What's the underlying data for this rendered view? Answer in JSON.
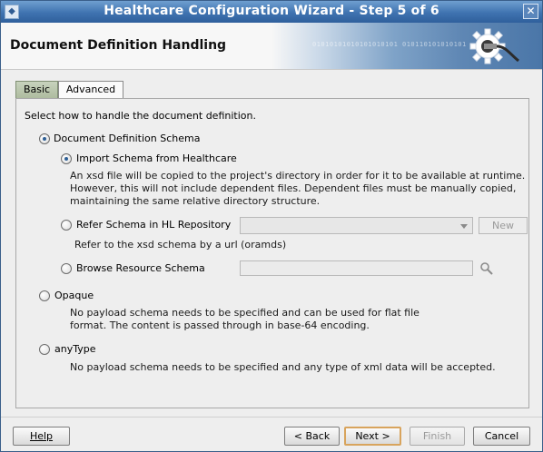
{
  "window": {
    "title": "Healthcare Configuration Wizard - Step 5 of 6",
    "close_glyph": "✕"
  },
  "header": {
    "heading": "Document Definition Handling",
    "banner_binary": "01010101010101010101 010110101010101"
  },
  "tabs": [
    {
      "label": "Basic",
      "selected": false
    },
    {
      "label": "Advanced",
      "selected": true
    }
  ],
  "panel": {
    "instruction": "Select how to handle the document definition.",
    "doc_def_schema": {
      "label": "Document Definition Schema",
      "selected": true
    },
    "import_schema": {
      "label": "Import Schema from Healthcare",
      "selected": true,
      "desc": [
        "An xsd file will be copied to the project's directory in order for it to be available at runtime.",
        "However, this will not include dependent files.  Dependent files must be manually copied,",
        "maintaining the same relative directory structure."
      ]
    },
    "refer_schema": {
      "label": "Refer Schema in HL Repository",
      "selected": false,
      "combo_value": "",
      "new_button": "New",
      "desc": "Refer to the xsd schema by a url (oramds)"
    },
    "browse_schema": {
      "label": "Browse Resource Schema",
      "selected": false,
      "input_value": ""
    },
    "opaque": {
      "label": "Opaque",
      "selected": false,
      "desc": [
        "No payload schema needs to be specified and can be used for flat file",
        "format. The content is passed through in base-64 encoding."
      ]
    },
    "anytype": {
      "label": "anyType",
      "selected": false,
      "desc": "No payload schema needs to be specified and any type of xml data will be accepted."
    }
  },
  "footer": {
    "help": "Help",
    "back": "< Back",
    "next": "Next >",
    "finish": "Finish",
    "cancel": "Cancel"
  },
  "colors": {
    "titlebar": "#3f73b0",
    "selected_radio": "#2e5f95",
    "default_button_border": "#d8a45d",
    "basic_tab": "#aebc9f"
  }
}
